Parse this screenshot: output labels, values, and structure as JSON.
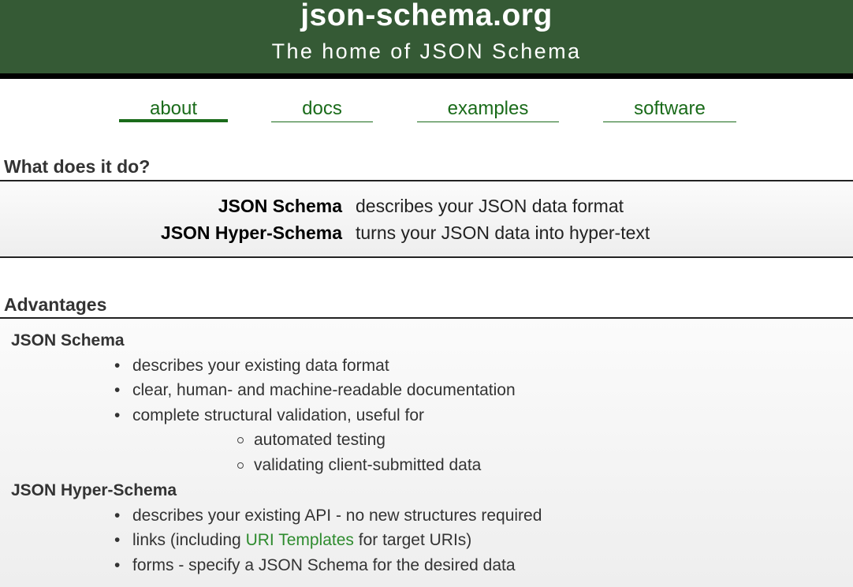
{
  "header": {
    "title": "json-schema.org",
    "tagline": "The home of JSON Schema",
    "bg_color": "#355a35"
  },
  "nav": [
    {
      "label": "about",
      "active": true
    },
    {
      "label": "docs",
      "active": false
    },
    {
      "label": "examples",
      "active": false
    },
    {
      "label": "software",
      "active": false
    }
  ],
  "what": {
    "heading": "What does it do?",
    "rows": [
      {
        "term": "JSON Schema",
        "desc": "describes your JSON data format"
      },
      {
        "term": "JSON Hyper-Schema",
        "desc": "turns your JSON data into hyper-text"
      }
    ]
  },
  "advantages": {
    "heading": "Advantages",
    "schema": {
      "title": "JSON Schema",
      "items": [
        "describes your existing data format",
        "clear, human- and machine-readable documentation",
        "complete structural validation, useful for"
      ],
      "subitems": [
        "automated testing",
        "validating client-submitted data"
      ]
    },
    "hyper": {
      "title": "JSON Hyper-Schema",
      "items": [
        "describes your existing API - no new structures required"
      ],
      "links_item": {
        "before": "links (including ",
        "link": "URI Templates",
        "after": " for target URIs)"
      },
      "forms_item": "forms - specify a JSON Schema for the desired data"
    }
  },
  "colors": {
    "link_green": "#1a6b1a",
    "uri_link": "#2e8b2e"
  }
}
